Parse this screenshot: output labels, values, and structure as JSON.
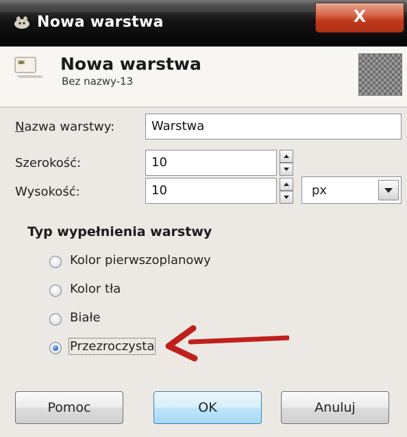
{
  "window": {
    "title": "Nowa warstwa",
    "close_label": "X"
  },
  "header": {
    "title": "Nowa warstwa",
    "subtitle": "Bez nazwy-13"
  },
  "form": {
    "name_label": "Nazwa warstwy:",
    "name_value": "Warstwa",
    "width_label": "Szerokość:",
    "width_value": "10",
    "height_label": "Wysokość:",
    "height_value": "10",
    "unit_value": "px"
  },
  "fill": {
    "title": "Typ wypełnienia warstwy",
    "options": [
      {
        "label": "Kolor pierwszoplanowy",
        "selected": false
      },
      {
        "label": "Kolor tła",
        "selected": false
      },
      {
        "label": "Białe",
        "selected": false
      },
      {
        "label": "Przezroczysta",
        "selected": true
      }
    ]
  },
  "buttons": {
    "help": "Pomoc",
    "ok": "OK",
    "cancel": "Anuluj"
  },
  "colors": {
    "annotation_arrow": "#c0201c",
    "title_bar": "#0a0a0a",
    "close_button": "#c63d1f",
    "ok_button": "#bee6fd"
  },
  "icons": [
    "gimp-wilber-icon",
    "new-layer-icon",
    "transparent-preview-icon",
    "spin-up-icon",
    "spin-down-icon",
    "dropdown-arrow-icon",
    "red-annotation-arrow-icon"
  ]
}
